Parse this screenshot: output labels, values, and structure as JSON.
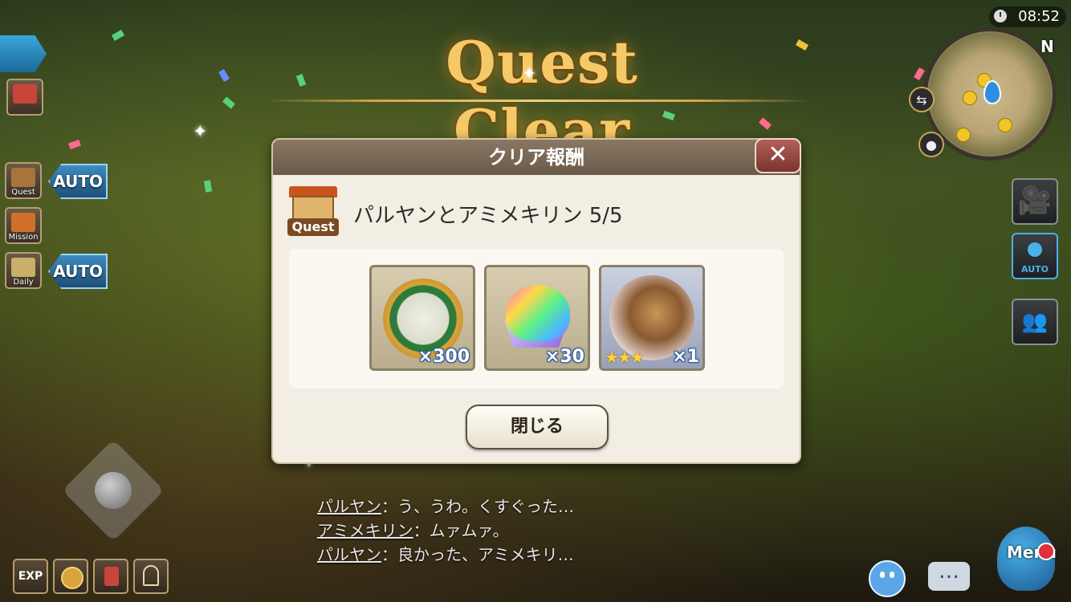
{
  "title": "Quest Clear",
  "clock": "08:52",
  "compass": "N",
  "left_sidebar": {
    "quest_label": "Quest",
    "mission_label": "Mission",
    "daily_label": "Daily",
    "auto_1": "AUTO",
    "auto_2": "AUTO"
  },
  "right_sidebar": {
    "auto_label": "AUTO"
  },
  "dialog": {
    "header": "クリア報酬",
    "close_glyph": "✕",
    "quest_tag": "Quest",
    "quest_name": "パルヤンとアミメキリン 5/5",
    "rewards": [
      {
        "name": "tiger-medal",
        "count": "×300"
      },
      {
        "name": "rainbow-gem",
        "count": "×30"
      },
      {
        "name": "giraffe-character",
        "count": "×1",
        "stars": "★★★"
      }
    ],
    "ok_button": "閉じる"
  },
  "chat_log": [
    {
      "speaker": "パルヤン",
      "text": "：う、うわ。くすぐった…"
    },
    {
      "speaker": "アミメキリン",
      "text": "：ムァムァ。"
    },
    {
      "speaker": "パルヤン",
      "text": "：良かった、アミメキリ…"
    }
  ],
  "bottom_left": {
    "exp_label": "EXP"
  },
  "bottom_right": {
    "menu_label": "Menu",
    "chat_glyph": "…"
  },
  "colors": {
    "title_gold": "#f6c968",
    "dialog_header": "#7a6856",
    "close_red": "#9a4a42",
    "reward_count_outline": "#2b5aa0"
  }
}
